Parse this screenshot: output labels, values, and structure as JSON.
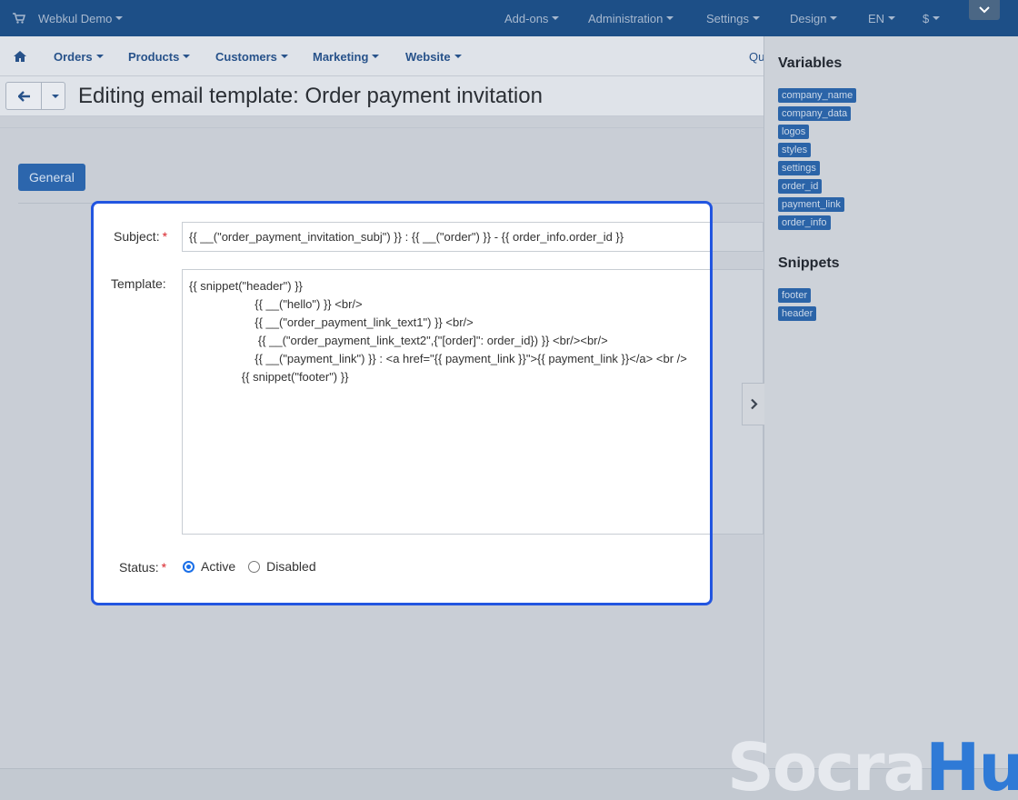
{
  "topbar": {
    "store_name": "Webkul Demo",
    "menus": [
      "Add-ons",
      "Administration",
      "Settings",
      "Design",
      "EN",
      "$"
    ]
  },
  "subnav": {
    "items": [
      "Orders",
      "Products",
      "Customers",
      "Marketing",
      "Website"
    ],
    "right_text": "Qu"
  },
  "page": {
    "title": "Editing email template: Order payment invitation"
  },
  "tabs": [
    "General"
  ],
  "form": {
    "subject_label": "Subject:",
    "subject_value": "{{ __(\"order_payment_invitation_subj\") }} : {{ __(\"order\") }} - {{ order_info.order_id }}",
    "template_label": "Template:",
    "template_lines": [
      "{{ snippet(\"header\") }}",
      "                    {{ __(\"hello\") }} <br/>",
      "                    {{ __(\"order_payment_link_text1\") }} <br/>",
      "                     {{ __(\"order_payment_link_text2\",{\"[order]\": order_id}) }} <br/><br/>",
      "                    {{ __(\"payment_link\") }} : <a href=\"{{ payment_link }}\">{{ payment_link }}</a> <br />",
      "                {{ snippet(\"footer\") }}"
    ],
    "status_label": "Status:",
    "status_options": [
      "Active",
      "Disabled"
    ],
    "status_selected": "Active",
    "required_marker": "*"
  },
  "sidebar": {
    "variables_title": "Variables",
    "variables": [
      "company_name",
      "company_data",
      "logos",
      "styles",
      "settings",
      "order_id",
      "payment_link",
      "order_info"
    ],
    "snippets_title": "Snippets",
    "snippets": [
      "footer",
      "header"
    ]
  },
  "watermark": {
    "part1": "Socra",
    "part2": "Hub"
  },
  "colors": {
    "accent": "#2c66ad",
    "modal_border": "#2255e0",
    "topbar": "#1d4f87"
  }
}
